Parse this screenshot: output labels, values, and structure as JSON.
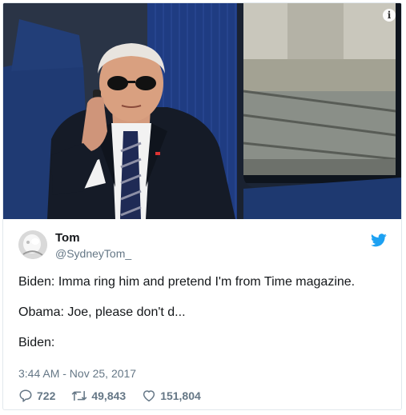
{
  "photo": {
    "info_icon": "i"
  },
  "tweet": {
    "author_name": "Tom",
    "author_handle": "@SydneyTom_",
    "lines": [
      "Biden: Imma ring him and pretend I'm from Time magazine.",
      "Obama: Joe, please don't d...",
      "Biden:"
    ],
    "timestamp": "3:44 AM - Nov 25, 2017"
  },
  "actions": {
    "replies": "722",
    "retweets": "49,843",
    "likes": "151,804"
  },
  "icons": {
    "brand": "twitter-bird-icon",
    "reply": "reply-icon",
    "retweet": "retweet-icon",
    "like": "heart-icon"
  },
  "colors": {
    "twitter_blue": "#1da1f2",
    "text": "#14171a",
    "muted": "#657786"
  }
}
